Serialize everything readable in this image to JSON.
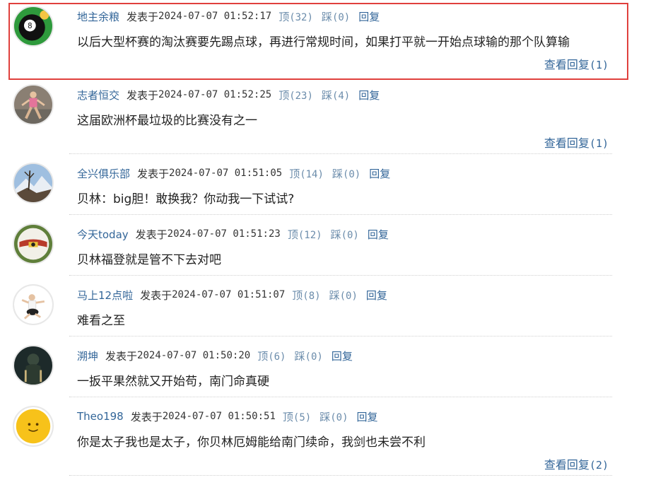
{
  "comments": [
    {
      "username": "地主余粮",
      "posted_label": "发表于",
      "timestamp": "2024-07-07 01:52:17",
      "up_label": "顶",
      "up_count": "(32)",
      "down_label": "踩",
      "down_count": "(0)",
      "reply_label": "回复",
      "text": "以后大型杯赛的淘汰赛要先踢点球，再进行常规时间，如果打平就一开始点球输的那个队算输",
      "view_replies_label": "查看回复",
      "view_replies_count": "(1)",
      "avatar_icon": "billiard-ball-icon",
      "highlighted": true
    },
    {
      "username": "志者恒交",
      "posted_label": "发表于",
      "timestamp": "2024-07-07 01:52:25",
      "up_label": "顶",
      "up_count": "(23)",
      "down_label": "踩",
      "down_count": "(4)",
      "reply_label": "回复",
      "text": "这届欧洲杯最垃圾的比赛没有之一",
      "view_replies_label": "查看回复",
      "view_replies_count": "(1)",
      "avatar_icon": "person-photo-icon"
    },
    {
      "username": "全兴俱乐部",
      "posted_label": "发表于",
      "timestamp": "2024-07-07 01:51:05",
      "up_label": "顶",
      "up_count": "(14)",
      "down_label": "踩",
      "down_count": "(0)",
      "reply_label": "回复",
      "text": "贝林：big胆！敢换我？你动我一下试试?",
      "avatar_icon": "mountain-photo-icon"
    },
    {
      "username": "今天today",
      "posted_label": "发表于",
      "timestamp": "2024-07-07 01:51:23",
      "up_label": "顶",
      "up_count": "(12)",
      "down_label": "踩",
      "down_count": "(0)",
      "reply_label": "回复",
      "text": "贝林福登就是管不下去对吧",
      "avatar_icon": "soccer-ball-icon"
    },
    {
      "username": "马上12点啦",
      "posted_label": "发表于",
      "timestamp": "2024-07-07 01:51:07",
      "up_label": "顶",
      "up_count": "(8)",
      "down_label": "踩",
      "down_count": "(0)",
      "reply_label": "回复",
      "text": "难看之至",
      "avatar_icon": "dancer-photo-icon"
    },
    {
      "username": "溯坤",
      "posted_label": "发表于",
      "timestamp": "2024-07-07 01:50:20",
      "up_label": "顶",
      "up_count": "(6)",
      "down_label": "踩",
      "down_count": "(0)",
      "reply_label": "回复",
      "text": "一扳平果然就又开始苟，南门命真硬",
      "avatar_icon": "dark-figure-photo-icon"
    },
    {
      "username": "Theo198",
      "posted_label": "发表于",
      "timestamp": "2024-07-07 01:50:51",
      "up_label": "顶",
      "up_count": "(5)",
      "down_label": "踩",
      "down_count": "(0)",
      "reply_label": "回复",
      "text": "你是太子我也是太子，你贝林厄姆能给南门续命，我剑也未尝不利",
      "view_replies_label": "查看回复",
      "view_replies_count": "(2)",
      "avatar_icon": "smiley-face-icon"
    }
  ],
  "colors": {
    "link": "#336699",
    "action": "#6b8cab",
    "highlight_border": "#e0403d",
    "text": "#222222"
  }
}
